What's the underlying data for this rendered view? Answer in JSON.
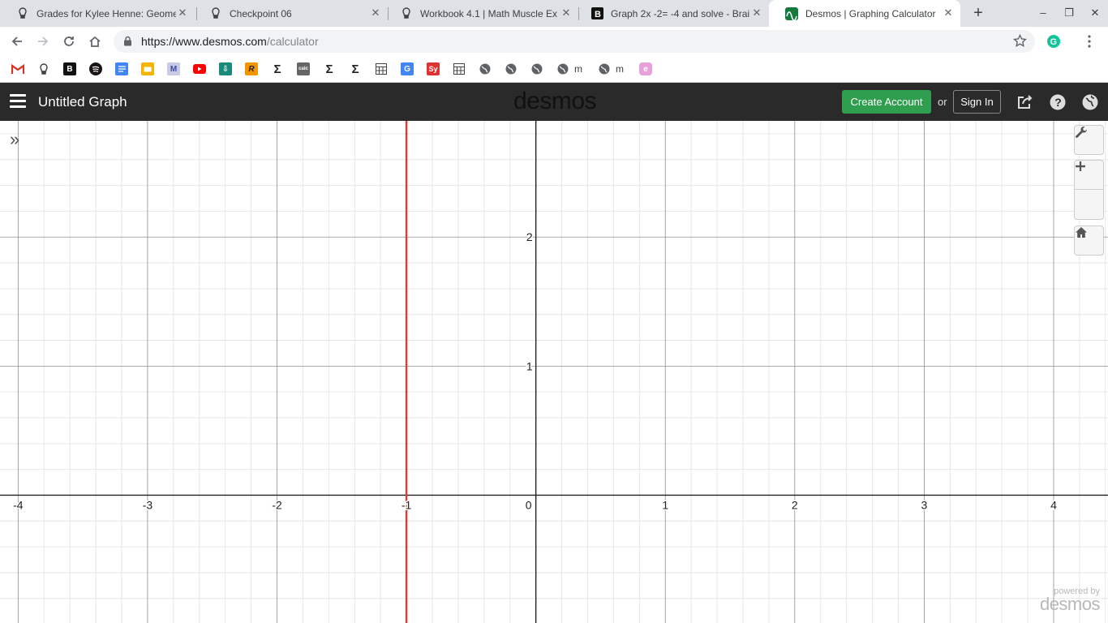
{
  "browser": {
    "tabs": [
      {
        "title": "Grades for Kylee Henne: Geome",
        "icon": "canvas-icon",
        "active": false
      },
      {
        "title": "Checkpoint 06",
        "icon": "canvas-icon",
        "active": false
      },
      {
        "title": "Workbook 4.1 | Math Muscle Ex",
        "icon": "canvas-icon",
        "active": false
      },
      {
        "title": "Graph 2x -2= -4 and solve - Brai",
        "icon": "brainly-icon",
        "active": false
      },
      {
        "title": "Desmos | Graphing Calculator",
        "icon": "desmos-icon",
        "active": true
      }
    ],
    "url_host": "https://www.desmos.com",
    "url_path": "/calculator",
    "bookmarks": [
      {
        "icon": "gmail-icon",
        "label": ""
      },
      {
        "icon": "canvas-icon",
        "label": ""
      },
      {
        "icon": "brainly-icon",
        "label": ""
      },
      {
        "icon": "spotify-icon",
        "label": ""
      },
      {
        "icon": "docs-icon",
        "label": ""
      },
      {
        "icon": "slides-icon",
        "label": ""
      },
      {
        "icon": "mathway-icon",
        "label": ""
      },
      {
        "icon": "youtube-icon",
        "label": ""
      },
      {
        "icon": "download-icon",
        "label": ""
      },
      {
        "icon": "r-icon",
        "label": ""
      },
      {
        "icon": "sigma-icon",
        "label": ""
      },
      {
        "icon": "geo-calc-icon",
        "label": ""
      },
      {
        "icon": "sigma-icon",
        "label": ""
      },
      {
        "icon": "sigma-icon",
        "label": ""
      },
      {
        "icon": "calculator-icon",
        "label": ""
      },
      {
        "icon": "translate-icon",
        "label": ""
      },
      {
        "icon": "symbolab-icon",
        "label": ""
      },
      {
        "icon": "calculator-icon",
        "label": ""
      },
      {
        "icon": "globe-icon",
        "label": ""
      },
      {
        "icon": "globe-icon",
        "label": ""
      },
      {
        "icon": "globe-icon",
        "label": ""
      },
      {
        "icon": "globe-icon",
        "label": "m"
      },
      {
        "icon": "globe-icon",
        "label": "m"
      },
      {
        "icon": "ebook-icon",
        "label": ""
      }
    ]
  },
  "desmos": {
    "graph_title": "Untitled Graph",
    "logo": "desmos",
    "create_account": "Create Account",
    "or": "or",
    "sign_in": "Sign In",
    "watermark_powered": "powered by",
    "watermark_brand": "desmos"
  },
  "chart_data": {
    "type": "line",
    "title": "",
    "xlabel": "",
    "ylabel": "",
    "xlim": [
      -4.14,
      4.42
    ],
    "ylim": [
      -0.99,
      2.9
    ],
    "grid": true,
    "x_ticks": [
      "-4",
      "-3",
      "-2",
      "-1",
      "0",
      "1",
      "2",
      "3",
      "4"
    ],
    "y_ticks": [
      "1",
      "2"
    ],
    "series": [
      {
        "kind": "vertical",
        "x": -1,
        "color": "#c74440"
      }
    ]
  }
}
